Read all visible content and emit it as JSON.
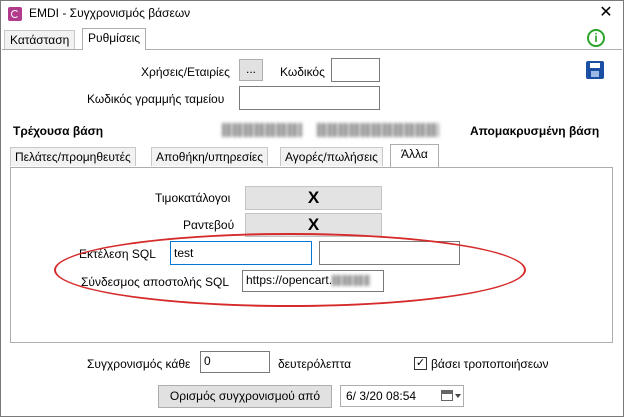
{
  "window": {
    "title": "EMDI - Συγχρονισμός βάσεων",
    "close_glyph": "✕"
  },
  "tabs": [
    "Κατάσταση",
    "Ρυθμίσεις"
  ],
  "active_tab": "Ρυθμίσεις",
  "settings": {
    "users_companies_label": "Χρήσεις/Εταιρίες",
    "browse_button": "...",
    "code_label": "Κωδικός",
    "code_value": "",
    "cash_line_code_label": "Κωδικός γραμμής ταμείου",
    "cash_line_code_value": "",
    "current_db_label": "Τρέχουσα βάση",
    "remote_db_label": "Απομακρυσμένη βάση"
  },
  "subtabs": [
    "Πελάτες/προμηθευτές",
    "Αποθήκη/υπηρεσίες",
    "Αγορές/πωλήσεις",
    "Άλλα"
  ],
  "active_subtab": "Άλλα",
  "other": {
    "pricelists_label": "Τιμοκατάλογοι",
    "pricelists_value": "X",
    "appointments_label": "Ραντεβού",
    "appointments_value": "X",
    "exec_sql_label": "Εκτέλεση SQL",
    "exec_sql_value": "test",
    "exec_sql_value2": "",
    "send_sql_link_label": "Σύνδεσμος αποστολής SQL",
    "send_sql_link_value": "https://opencart."
  },
  "footer": {
    "sync_every_label": "Συγχρονισμός κάθε",
    "sync_every_value": "0",
    "seconds_label": "δευτερόλεπτα",
    "on_changes_label": "βάσει τροποποιήσεων",
    "on_changes_checked": true,
    "set_sync_from_button": "Ορισμός συγχρονισμού από",
    "date_value": "6/  3/20 08:54"
  },
  "icons": {
    "app": "app-icon",
    "info": "info-icon",
    "save": "save-icon",
    "calendar": "calendar-icon"
  },
  "colors": {
    "info": "#2aa52a",
    "save": "#1a4fa3",
    "highlight_ellipse": "#d62b2b",
    "focus_border": "#0078d7"
  }
}
